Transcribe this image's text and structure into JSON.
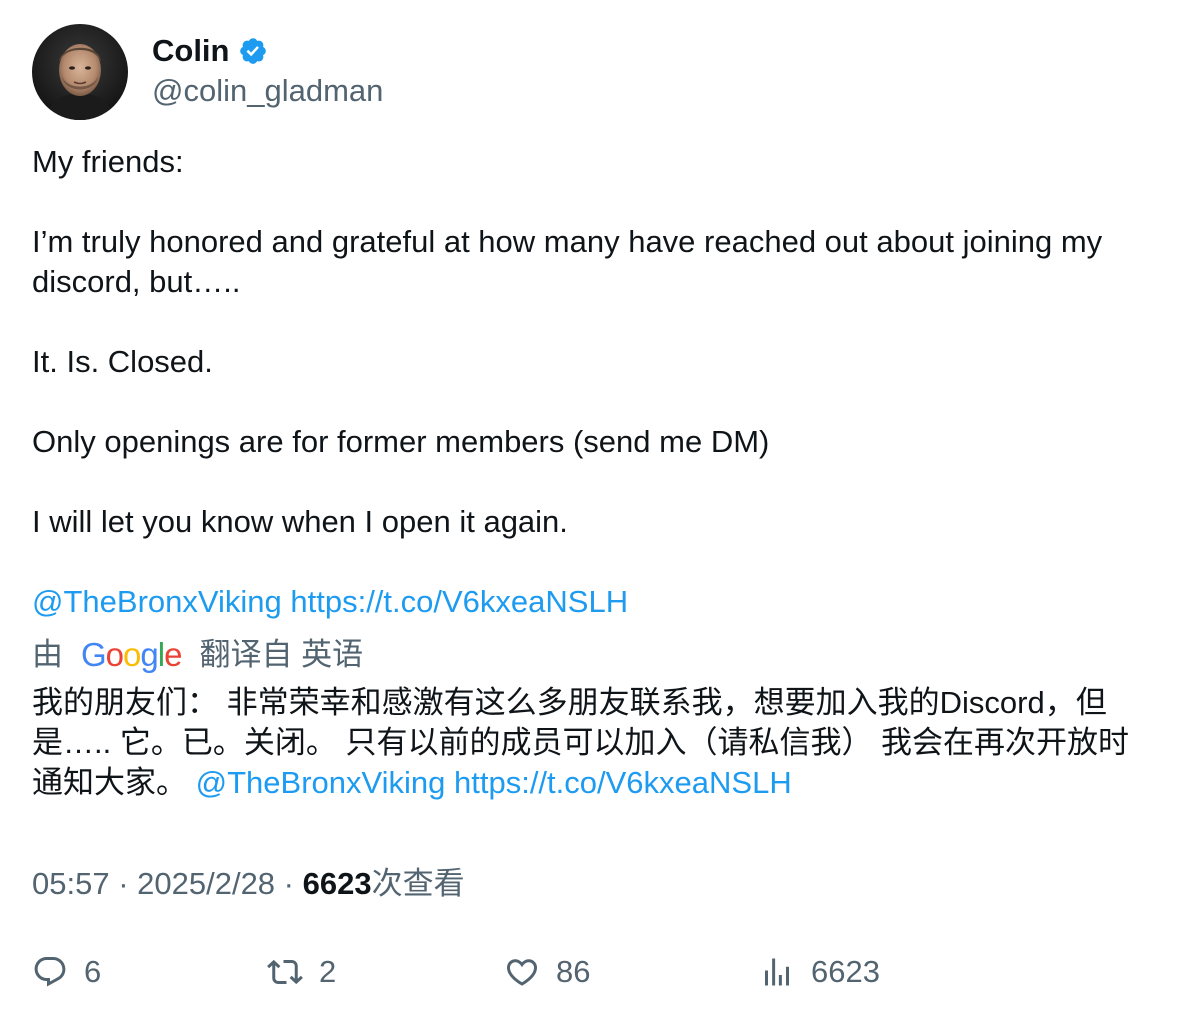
{
  "author": {
    "display_name": "Colin",
    "handle": "@colin_gladman",
    "verified": true,
    "verified_color": "#1d9bf0"
  },
  "tweet": {
    "lines": [
      "My friends:",
      "I’m truly honored and grateful at how many have reached out about joining my discord, but…..",
      "It. Is. Closed.",
      "Only openings are for former members (send me DM)",
      "I will let you know when I open it again."
    ],
    "mention": "@TheBronxViking",
    "link": "https://t.co/V6kxeaNSLH"
  },
  "translation": {
    "by_label": "由",
    "provider": "Google",
    "translated_from_label": "翻译自 英语",
    "text": "我的朋友们： 非常荣幸和感激有这么多朋友联系我，想要加入我的Discord，但是….. 它。已。关闭。 只有以前的成员可以加入（请私信我） 我会在再次开放时通知大家。",
    "mention": "@TheBronxViking",
    "link": "https://t.co/V6kxeaNSLH"
  },
  "meta": {
    "time": "05:57",
    "separator": " · ",
    "date": "2025/2/28",
    "views_count": "6623",
    "views_label": "次查看"
  },
  "actions": {
    "replies": "6",
    "retweets": "2",
    "likes": "86",
    "views": "6623"
  },
  "colors": {
    "text": "#0f1419",
    "secondary": "#536471",
    "link": "#1d9bf0"
  }
}
